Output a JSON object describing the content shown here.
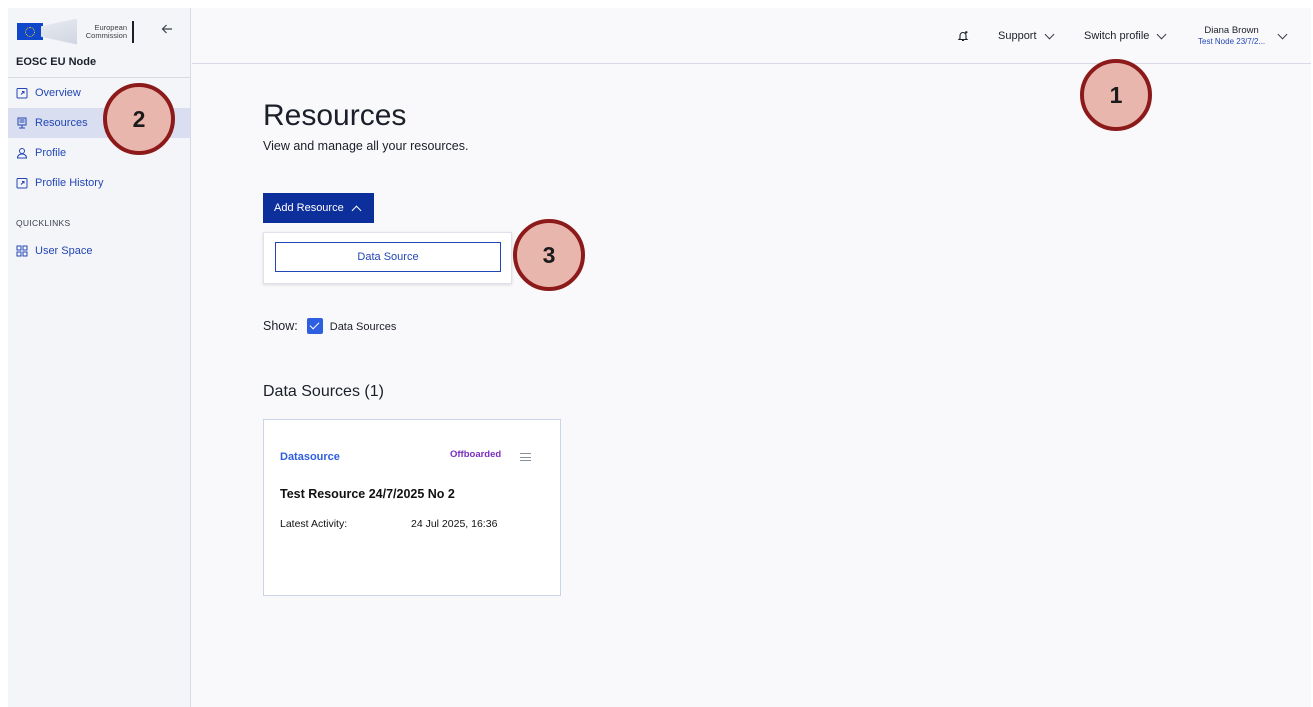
{
  "brand": {
    "line1": "European",
    "line2": "Commission"
  },
  "sidebar": {
    "title": "EOSC EU Node",
    "items": [
      {
        "label": "Overview",
        "icon": "calendar-link-icon",
        "active": false
      },
      {
        "label": "Resources",
        "icon": "document-list-icon",
        "active": true
      },
      {
        "label": "Profile",
        "icon": "person-icon",
        "active": false
      },
      {
        "label": "Profile History",
        "icon": "calendar-link-icon",
        "active": false
      }
    ],
    "quicklinks_title": "QUICKLINKS",
    "quicklinks": [
      {
        "label": "User Space",
        "icon": "grid-icon"
      }
    ]
  },
  "header": {
    "support_label": "Support",
    "switch_profile_label": "Switch profile",
    "user_name": "Diana Brown",
    "user_org": "Test Node 23/7/2..."
  },
  "main": {
    "title": "Resources",
    "subtitle": "View and manage all your resources.",
    "add_button_label": "Add Resource",
    "dropdown_option": "Data Source",
    "show_label": "Show:",
    "filter_label": "Data Sources",
    "filter_checked": true,
    "section_title": "Data Sources (1)",
    "card": {
      "type": "Datasource",
      "status": "Offboarded",
      "title": "Test Resource 24/7/2025 No 2",
      "activity_label": "Latest Activity:",
      "activity_value": "24 Jul 2025, 16:36"
    }
  },
  "callouts": [
    "1",
    "2",
    "3"
  ],
  "colors": {
    "primary": "#0d2f9c",
    "link": "#2246b5",
    "status": "#7a2fbe",
    "callout_border": "#8c1a1a",
    "callout_fill": "#e9b6ae"
  }
}
